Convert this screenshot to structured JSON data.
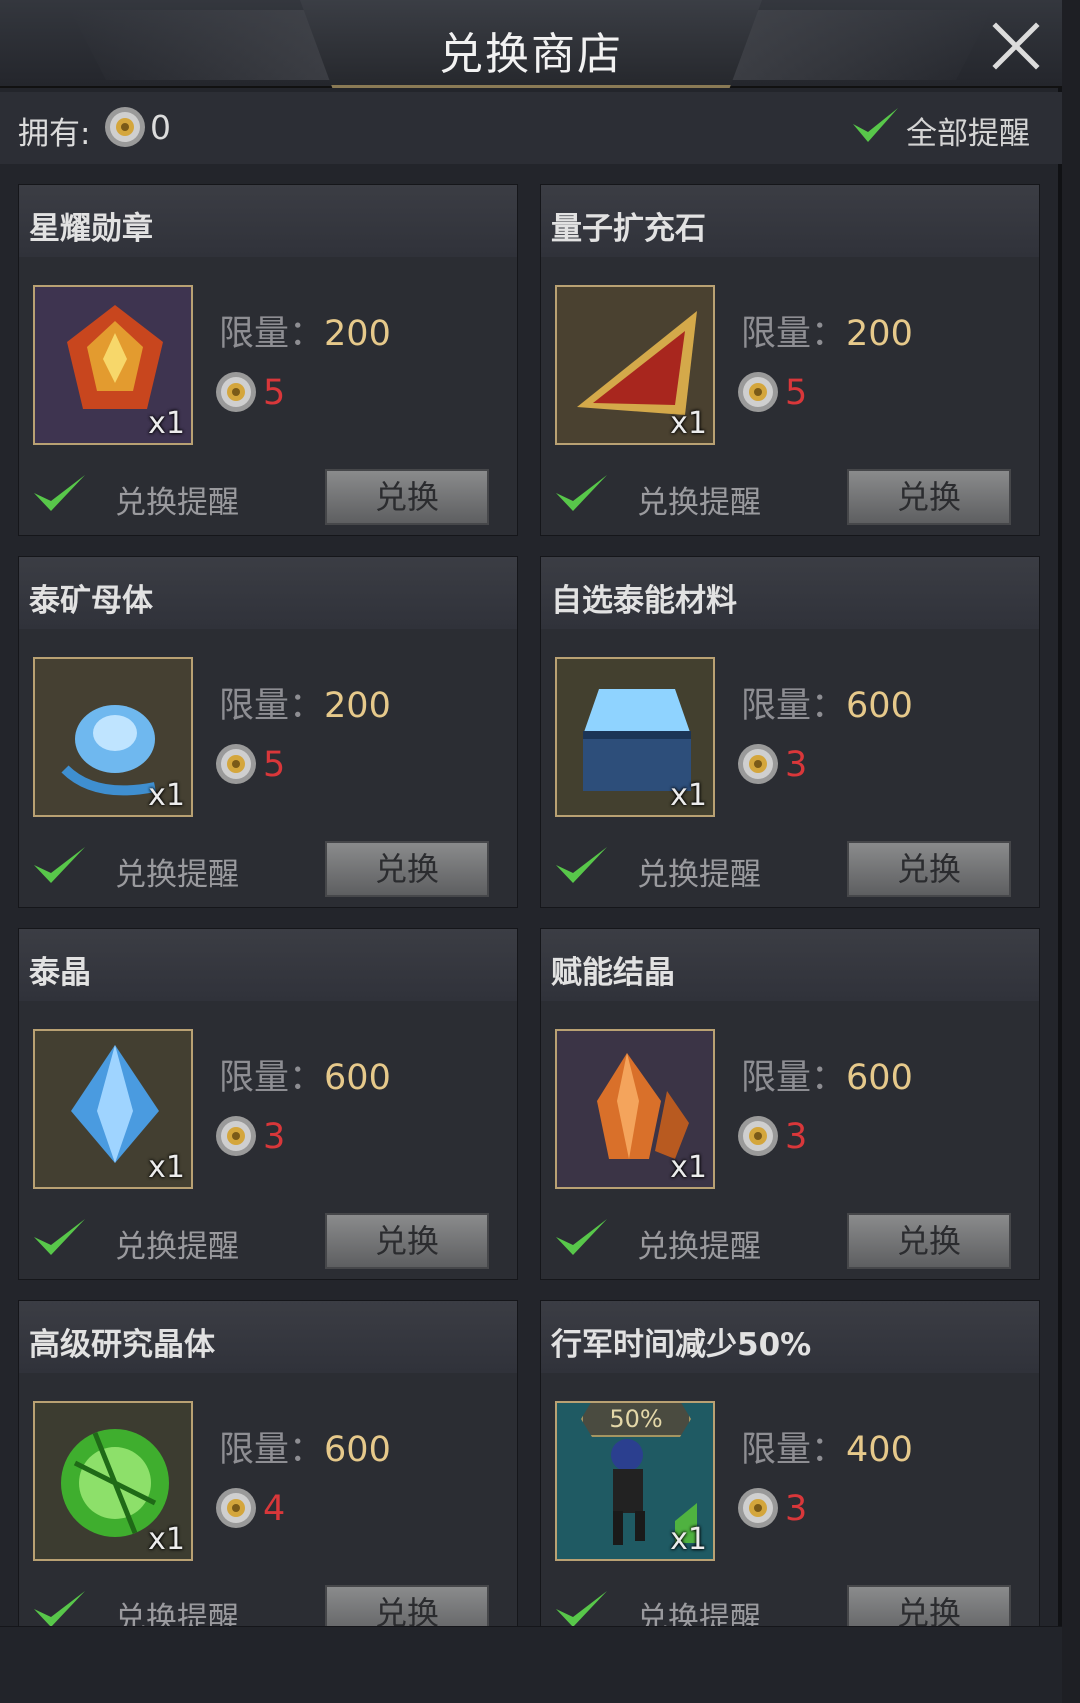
{
  "header": {
    "title": "兑换商店"
  },
  "owned": {
    "label": "拥有:",
    "count": "0"
  },
  "all_remind": {
    "label": "全部提醒",
    "checked": true
  },
  "limit_label": "限量",
  "limit_sep": "：",
  "colors": {
    "accent_gold": "#e6c98b",
    "cost_red": "#d9373a",
    "check_green": "#58c74a"
  },
  "items": [
    {
      "name": "星耀勋章",
      "icon": "star-medal-icon",
      "qty": "x1",
      "limit": "200",
      "cost": "5",
      "remind_label": "兑换提醒",
      "button": "兑换"
    },
    {
      "name": "量子扩充石",
      "icon": "quantum-stone-icon",
      "qty": "x1",
      "limit": "200",
      "cost": "5",
      "remind_label": "兑换提醒",
      "button": "兑换"
    },
    {
      "name": "泰矿母体",
      "icon": "ore-matrix-icon",
      "qty": "x1",
      "limit": "200",
      "cost": "5",
      "remind_label": "兑换提醒",
      "button": "兑换"
    },
    {
      "name": "自选泰能材料",
      "icon": "material-chest-icon",
      "qty": "x1",
      "limit": "600",
      "cost": "3",
      "remind_label": "兑换提醒",
      "button": "兑换"
    },
    {
      "name": "泰晶",
      "icon": "blue-crystal-icon",
      "qty": "x1",
      "limit": "600",
      "cost": "3",
      "remind_label": "兑换提醒",
      "button": "兑换"
    },
    {
      "name": "赋能结晶",
      "icon": "orange-crystal-icon",
      "qty": "x1",
      "limit": "600",
      "cost": "3",
      "remind_label": "兑换提醒",
      "button": "兑换"
    },
    {
      "name": "高级研究晶体",
      "icon": "green-orb-icon",
      "qty": "x1",
      "limit": "600",
      "cost": "4",
      "remind_label": "兑换提醒",
      "button": "兑换"
    },
    {
      "name": "行军时间减少50%",
      "icon": "marching-soldier-icon",
      "qty": "x1",
      "badge": "50%",
      "limit": "400",
      "cost": "3",
      "remind_label": "兑换提醒",
      "button": "兑换"
    }
  ]
}
